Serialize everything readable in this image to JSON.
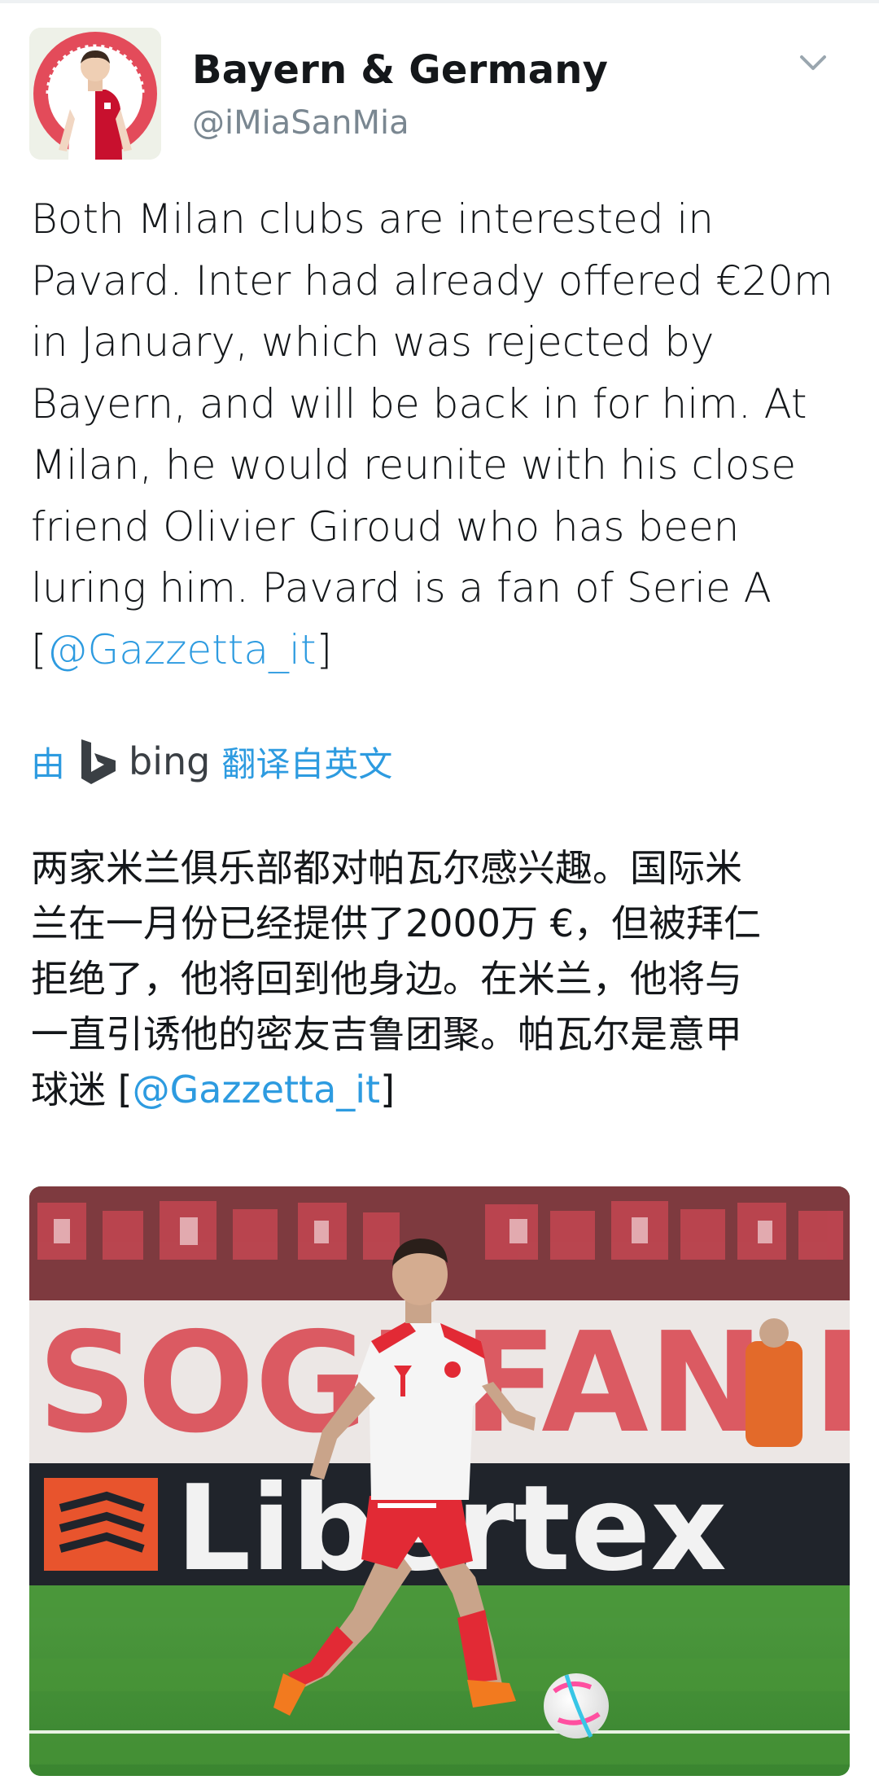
{
  "tweet": {
    "display_name": "Bayern & Germany",
    "handle": "@iMiaSanMia",
    "text_before_mention": "Both Milan clubs are interested in\nPavard. Inter had already offered €20m\nin January, which was rejected by\nBayern, and will be back in for him. At\nMilan, he would reunite with his close\nfriend Olivier Giroud who has been\nluring him. Pavard is a fan of Serie A\n[",
    "mention": "@Gazzetta_it",
    "text_after_mention": "]"
  },
  "translation": {
    "prefix": "由",
    "provider": "bing",
    "suffix": "翻译自英文",
    "text_before_mention": "两家米兰俱乐部都对帕瓦尔感兴趣。国际米\n兰在一月份已经提供了2000万 €，但被拜仁\n拒绝了，他将回到他身边。在米兰，他将与\n一直引诱他的密友吉鲁团聚。帕瓦尔是意甲\n球迷 [",
    "mention": "@Gazzetta_it",
    "text_after_mention": "]"
  },
  "media": {
    "ad_board_text": "Libertex",
    "banner_text": "SOGEFAN DE"
  },
  "icons": {
    "menu": "chevron-down-icon",
    "bing": "bing-logo-icon"
  },
  "colors": {
    "link": "#2d9be0",
    "handle": "#7a8791",
    "text": "#14171a",
    "bayern_red": "#dc052d"
  }
}
